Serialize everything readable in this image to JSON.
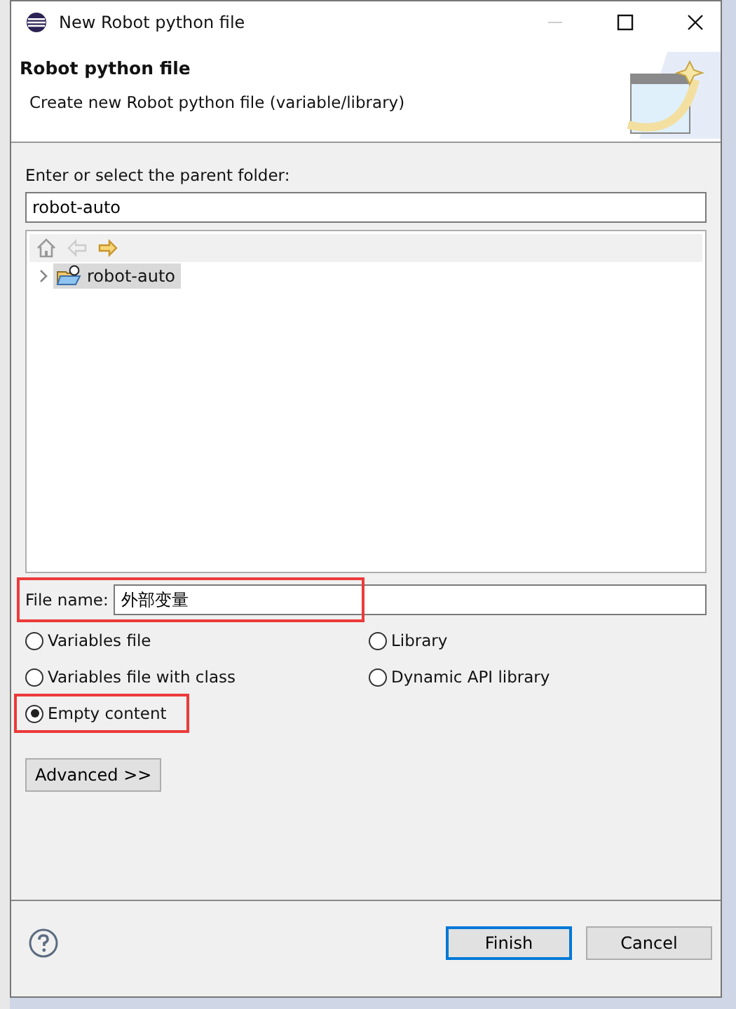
{
  "window": {
    "title": "New Robot python file"
  },
  "header": {
    "title": "Robot python file",
    "description": "Create new Robot python file (variable/library)"
  },
  "parent_folder": {
    "label": "Enter or select the parent folder:",
    "value": "robot-auto"
  },
  "tree": {
    "items": [
      {
        "label": "robot-auto",
        "selected": true,
        "expanded": false
      }
    ]
  },
  "file_name": {
    "label": "File name:",
    "value": "外部变量",
    "highlighted": true
  },
  "options": [
    {
      "label": "Variables file",
      "selected": false,
      "highlighted": false
    },
    {
      "label": "Library",
      "selected": false,
      "highlighted": false
    },
    {
      "label": "Variables file with class",
      "selected": false,
      "highlighted": false
    },
    {
      "label": "Dynamic API library",
      "selected": false,
      "highlighted": false
    },
    {
      "label": "Empty content",
      "selected": true,
      "highlighted": true
    }
  ],
  "advanced_button": "Advanced >>",
  "buttons": [
    {
      "label": "Finish",
      "default": true
    },
    {
      "label": "Cancel",
      "default": false
    }
  ]
}
